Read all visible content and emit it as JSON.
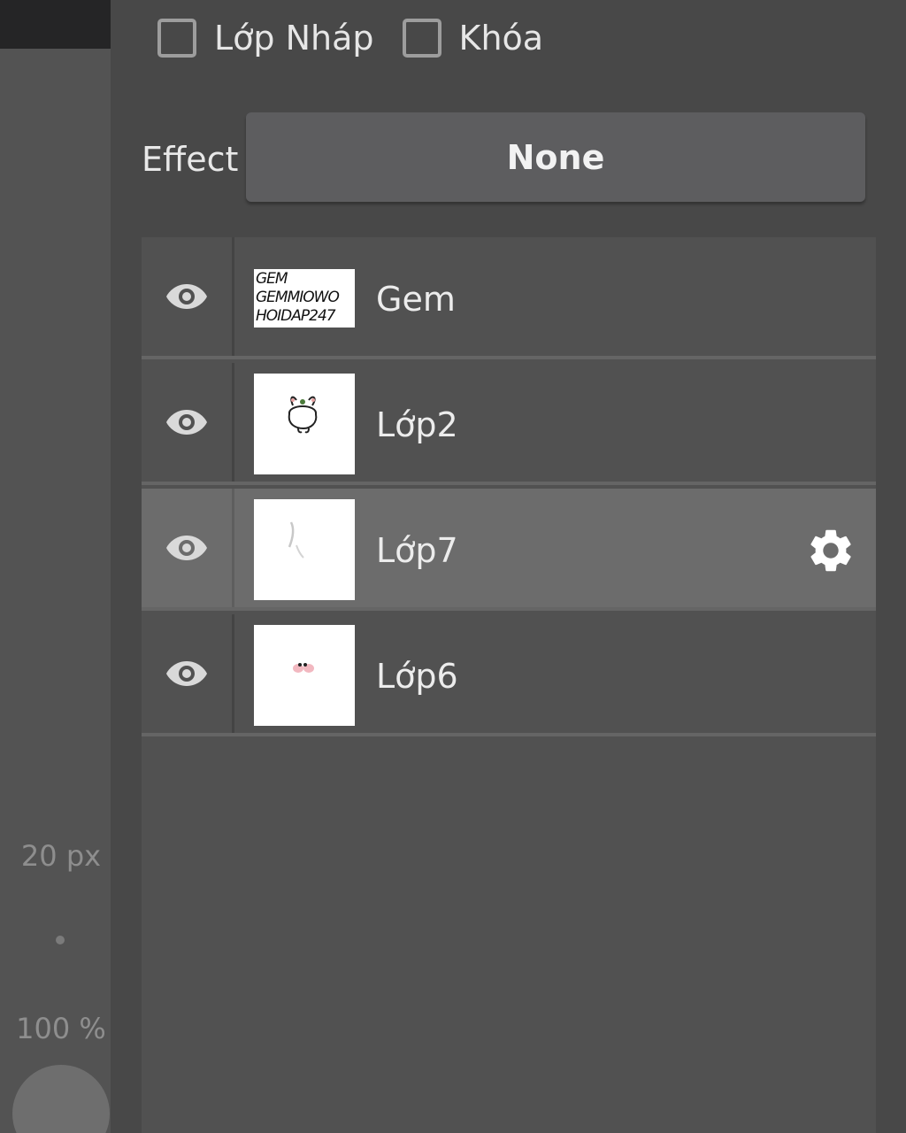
{
  "left_panel": {
    "brush_size": "20 px",
    "opacity": "100 %"
  },
  "options": {
    "draft_layer_label": "Lớp Nháp",
    "draft_layer_checked": false,
    "lock_label": "Khóa",
    "lock_checked": false
  },
  "effect": {
    "label": "Effect",
    "value": "None"
  },
  "layers": [
    {
      "name": "Gem",
      "visible": true,
      "selected": false,
      "thumb_text": [
        "GEM",
        "GEMMIOWO",
        "HOIDAP247"
      ]
    },
    {
      "name": "Lớp2",
      "visible": true,
      "selected": false
    },
    {
      "name": "Lớp7",
      "visible": true,
      "selected": true
    },
    {
      "name": "Lớp6",
      "visible": true,
      "selected": false
    }
  ],
  "colors": {
    "background": "#484848",
    "panel": "#515151",
    "selected_row": "#6c6c6c",
    "text": "#ececec"
  }
}
